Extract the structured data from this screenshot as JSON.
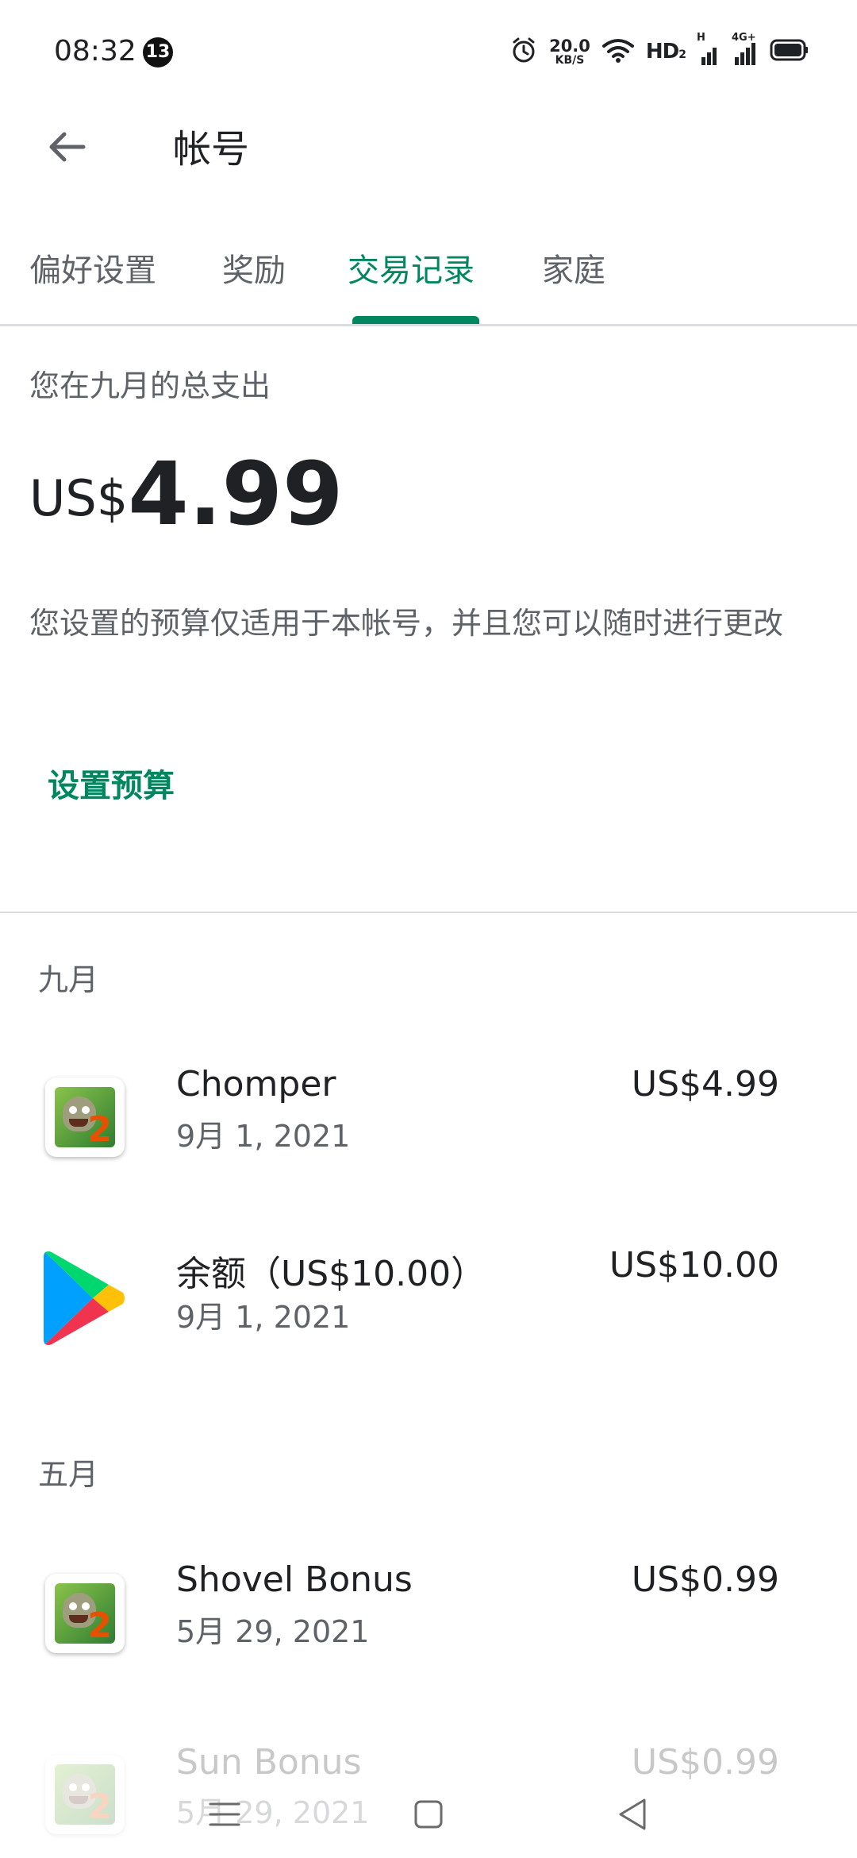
{
  "status_bar": {
    "time": "08:32",
    "notification_count": "13",
    "net_speed_value": "20.0",
    "net_speed_unit": "KB/S",
    "hd_label": "HD",
    "hd_sub": "2",
    "signal1_tag": "H",
    "signal2_tag": "4G+"
  },
  "app_bar": {
    "title": "帐号"
  },
  "tabs": [
    {
      "label": "偏好设置",
      "active": false
    },
    {
      "label": "奖励",
      "active": false
    },
    {
      "label": "交易记录",
      "active": true
    },
    {
      "label": "家庭",
      "active": false
    }
  ],
  "summary": {
    "label": "您在九月的总支出",
    "currency": "US$",
    "amount": "4.99",
    "note": "您设置的预算仅适用于本帐号，并且您可以随时进行更改",
    "budget_link": "设置预算"
  },
  "transactions": {
    "groups": [
      {
        "month": "九月",
        "items": [
          {
            "icon": "pvz2-app-icon",
            "name": "Chomper",
            "date": "9月 1, 2021",
            "amount": "US$4.99"
          },
          {
            "icon": "google-play-icon",
            "name": "余额（US$10.00）",
            "date": "9月 1, 2021",
            "amount": "US$10.00"
          }
        ]
      },
      {
        "month": "五月",
        "items": [
          {
            "icon": "pvz2-app-icon",
            "name": "Shovel Bonus",
            "date": "5月 29, 2021",
            "amount": "US$0.99"
          },
          {
            "icon": "pvz2-app-icon",
            "name": "Sun Bonus",
            "date": "5月 29, 2021",
            "amount": "US$0.99"
          }
        ]
      }
    ]
  },
  "nav_bar": {
    "menu_icon": "menu-icon",
    "home_icon": "home-square-icon",
    "back_icon": "back-triangle-icon"
  },
  "colors": {
    "accent": "#01875f",
    "text_primary": "#202124",
    "text_secondary": "#5f6368",
    "divider": "#dadce0"
  }
}
